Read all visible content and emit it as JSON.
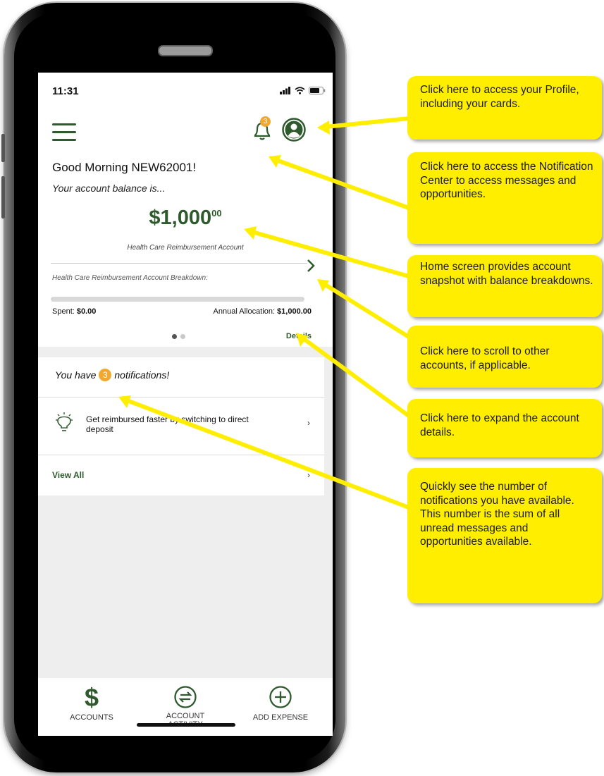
{
  "status_bar": {
    "time": "11:31"
  },
  "header": {
    "notification_count": "3"
  },
  "greeting": "Good Morning NEW62001!",
  "balance": {
    "label": "Your account balance is...",
    "amount": "$1,000",
    "cents": "00",
    "account_name": "Health Care Reimbursement Account"
  },
  "breakdown": {
    "title": "Health Care Reimbursement Account Breakdown:",
    "spent_label": "Spent: ",
    "spent_value": "$0.00",
    "allocation_label": "Annual Allocation: ",
    "allocation_value": "$1,000.00",
    "spent_fraction": 0,
    "details_label": "Details",
    "page_count": 2,
    "active_page": 1
  },
  "notifications": {
    "title_prefix": "You have",
    "count": "3",
    "title_suffix": "notifications!",
    "item_text": "Get reimbursed faster by switching to direct deposit",
    "view_all_label": "View All"
  },
  "bottom_nav": {
    "accounts_label": "ACCOUNTS",
    "activity_label_line1": "ACCOUNT",
    "activity_label_line2": "ACTIVITY",
    "add_expense_label": "ADD EXPENSE"
  },
  "callouts": [
    {
      "text": "Click here to access your Profile, including your cards."
    },
    {
      "text": "Click here to access the Notification Center to access messages and opportunities."
    },
    {
      "text": "Home screen provides account snapshot with balance breakdowns."
    },
    {
      "text": "Click here to scroll to other accounts, if applicable."
    },
    {
      "text": "Click here to expand the account details."
    },
    {
      "text": "Quickly see the number of notifications you have available. This number is the sum of all unread messages and opportunities available."
    }
  ],
  "colors": {
    "brand_green": "#2e5a2e",
    "badge_orange": "#f0a830",
    "callout_yellow": "#ffee00",
    "phone_frame": "#000000"
  }
}
